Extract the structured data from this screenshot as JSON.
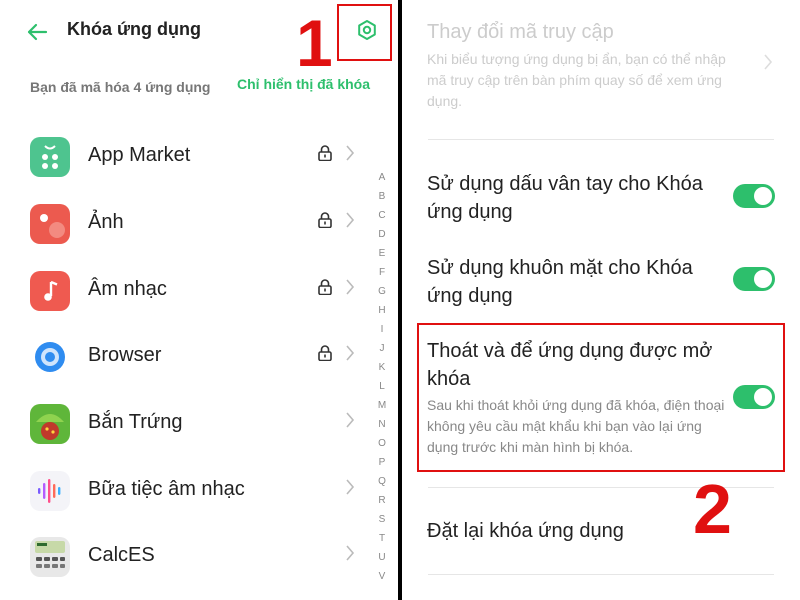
{
  "left": {
    "title": "Khóa ứng dụng",
    "summary": "Bạn đã mã hóa 4 ứng dụng",
    "show_locked": "Chỉ hiển thị đã khóa",
    "annotation": "1",
    "apps": [
      {
        "name": "App Market",
        "icon": "app-market-icon",
        "locked": true
      },
      {
        "name": "Ảnh",
        "icon": "photos-icon",
        "locked": true
      },
      {
        "name": "Âm nhạc",
        "icon": "music-icon",
        "locked": true
      },
      {
        "name": "Browser",
        "icon": "browser-icon",
        "locked": true
      },
      {
        "name": "Bắn Trứng",
        "icon": "egg-shooter-icon",
        "locked": false
      },
      {
        "name": "Bữa tiệc âm nhạc",
        "icon": "music-party-icon",
        "locked": false
      },
      {
        "name": "CalcES",
        "icon": "calculator-icon",
        "locked": false
      }
    ],
    "alphabet": [
      "A",
      "B",
      "C",
      "D",
      "E",
      "F",
      "G",
      "H",
      "I",
      "J",
      "K",
      "L",
      "M",
      "N",
      "O",
      "P",
      "Q",
      "R",
      "S",
      "T",
      "U",
      "V"
    ]
  },
  "right": {
    "change_code": {
      "title": "Thay đổi mã truy cập",
      "desc": "Khi biểu tượng ứng dụng bị ẩn, bạn có thể nhập mã truy cập trên bàn phím quay số để xem ứng dụng."
    },
    "fingerprint": {
      "title": "Sử dụng dấu vân tay cho Khóa ứng dụng",
      "enabled": true
    },
    "face": {
      "title": "Sử dụng khuôn mặt cho Khóa ứng dụng",
      "enabled": true
    },
    "exit_unlock": {
      "title": "Thoát và để ứng dụng được mở khóa",
      "desc": "Sau khi thoát khỏi ứng dụng đã khóa, điện thoại không yêu cầu mật khẩu khi bạn vào lại ứng dụng trước khi màn hình bị khóa.",
      "enabled": true
    },
    "reset": {
      "title": "Đặt lại khóa ứng dụng"
    },
    "annotation": "2"
  },
  "colors": {
    "accent": "#2dbf6c",
    "annotation": "#e01010"
  }
}
